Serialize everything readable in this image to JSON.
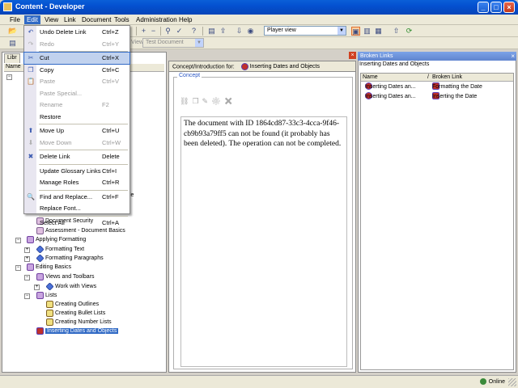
{
  "window": {
    "title": "Content - Developer"
  },
  "menubar": [
    "File",
    "Edit",
    "View",
    "Link",
    "Document",
    "Tools",
    "Administration",
    "Help"
  ],
  "toolbar": {
    "view_combo": "Player view",
    "doc_label": "View:",
    "doc_combo": "Test Document"
  },
  "left_panel": {
    "tab": "Libr",
    "col_name": "Name",
    "tree": [
      {
        "label": "le",
        "indent": 0
      },
      {
        "label": "Document Security",
        "indent": 2
      },
      {
        "label": "Assessment - Document Basics",
        "indent": 2
      },
      {
        "label": "Applying Formatting",
        "indent": 1
      },
      {
        "label": "Formatting Text",
        "indent": 2
      },
      {
        "label": "Formatting Paragraphs",
        "indent": 2
      },
      {
        "label": "Editing Basics",
        "indent": 1
      },
      {
        "label": "Views and Toolbars",
        "indent": 2
      },
      {
        "label": "Work with Views",
        "indent": 3
      },
      {
        "label": "Lists",
        "indent": 2
      },
      {
        "label": "Creating Outlines",
        "indent": 3
      },
      {
        "label": "Creating Bullet Lists",
        "indent": 3
      },
      {
        "label": "Creating Number Lists",
        "indent": 3
      },
      {
        "label": "Inserting Dates and Objects",
        "indent": 1,
        "selected": true
      }
    ]
  },
  "middle": {
    "header_label": "Concept/Introduction for:",
    "header_doc": "Inserting Dates and Objects",
    "concept_label": "Concept",
    "message": "The document with ID 1864cd87-33c3-4cca-9f46-cb9b93a79ff5 can not be found (it probably has been deleted). The operation can not be completed."
  },
  "right_panel": {
    "title": "Broken Links",
    "subtitle": "Inserting Dates and Objects",
    "col_name": "Name",
    "col_link": "Broken Link",
    "rows": [
      {
        "name": "Inserting Dates an...",
        "link": "Formatting the Date"
      },
      {
        "name": "Inserting Dates an...",
        "link": "Inserting the Date"
      }
    ]
  },
  "edit_menu": [
    {
      "label": "Undo Delete Link",
      "accel": "Ctrl+Z",
      "icon": "↶",
      "disabled": false
    },
    {
      "label": "Redo",
      "accel": "Ctrl+Y",
      "icon": "↷",
      "disabled": true
    },
    {
      "sep": true
    },
    {
      "label": "Cut",
      "accel": "Ctrl+X",
      "icon": "✂",
      "disabled": false,
      "highlight": true
    },
    {
      "label": "Copy",
      "accel": "Ctrl+C",
      "icon": "❐",
      "disabled": false
    },
    {
      "label": "Paste",
      "accel": "Ctrl+V",
      "icon": "📋",
      "disabled": true
    },
    {
      "label": "Paste Special...",
      "accel": "",
      "icon": "",
      "disabled": true
    },
    {
      "label": "Rename",
      "accel": "F2",
      "icon": "",
      "disabled": true
    },
    {
      "label": "Restore",
      "accel": "",
      "icon": "",
      "disabled": false
    },
    {
      "sep": true
    },
    {
      "label": "Move Up",
      "accel": "Ctrl+U",
      "icon": "⬆",
      "disabled": false
    },
    {
      "label": "Move Down",
      "accel": "Ctrl+W",
      "icon": "⬇",
      "disabled": true
    },
    {
      "sep": true
    },
    {
      "label": "Delete Link",
      "accel": "Delete",
      "icon": "✖",
      "disabled": false
    },
    {
      "sep": true
    },
    {
      "label": "Update Glossary Links",
      "accel": "Ctrl+I",
      "icon": "",
      "disabled": false
    },
    {
      "label": "Manage Roles",
      "accel": "Ctrl+R",
      "icon": "",
      "disabled": false
    },
    {
      "sep": true
    },
    {
      "label": "Find and Replace...",
      "accel": "Ctrl+F",
      "icon": "🔍",
      "disabled": false
    },
    {
      "label": "Replace Font...",
      "accel": "",
      "icon": "",
      "disabled": false
    },
    {
      "sep": true
    },
    {
      "label": "Select All",
      "accel": "Ctrl+A",
      "icon": "",
      "disabled": false
    }
  ],
  "status": {
    "online": "Online"
  },
  "colors": {
    "accent": "#316ac5",
    "title": "#0450d0"
  }
}
